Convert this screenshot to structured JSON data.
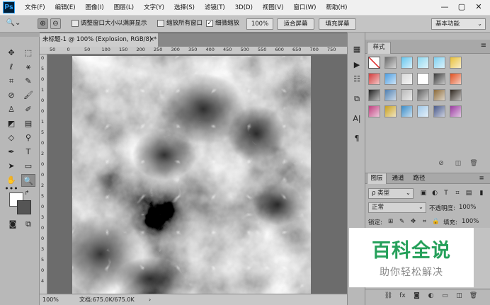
{
  "app": {
    "logo": "Ps"
  },
  "menubar": {
    "items": [
      "文件(F)",
      "编辑(E)",
      "图像(I)",
      "图层(L)",
      "文字(Y)",
      "选择(S)",
      "滤镜(T)",
      "3D(D)",
      "视图(V)",
      "窗口(W)",
      "帮助(H)"
    ],
    "window_controls": {
      "minimize": "—",
      "restore": "▢",
      "close": "✕"
    }
  },
  "options_bar": {
    "resize_windows_label": "调整窗口大小以满屏显示",
    "resize_windows_checked": false,
    "zoom_all_windows_label": "缩放所有窗口",
    "zoom_all_windows_checked": false,
    "scrubby_zoom_label": "细微缩放",
    "scrubby_zoom_checked": true,
    "zoom_value": "100%",
    "fit_screen_label": "适合屏幕",
    "fill_screen_label": "填充屏幕",
    "workspace": "基本功能"
  },
  "document": {
    "tab_title": "未标题-1 @ 100% (Explosion, RGB/8) *",
    "tab_close": "×",
    "ruler_h_ticks": [
      "50",
      "0",
      "50",
      "100",
      "150",
      "200",
      "250",
      "300",
      "350",
      "400",
      "450",
      "500",
      "550",
      "600",
      "650",
      "700",
      "750"
    ],
    "ruler_v_ticks": [
      "0",
      "5",
      "0",
      "1",
      "0",
      "0",
      "1",
      "5",
      "0",
      "2",
      "0",
      "0",
      "2",
      "5",
      "0",
      "3",
      "0",
      "0",
      "3",
      "5",
      "0",
      "4"
    ]
  },
  "status_bar": {
    "zoom": "100%",
    "doc_info": "文档:675.0K/675.0K",
    "arrow": "›"
  },
  "styles_panel": {
    "tab": "样式",
    "menu_icon": "≡",
    "swatch_colors": [
      [
        "#ffffff",
        "#6a6a6a",
        "#66c6ee",
        "#8ed8f0",
        "#7fd0f0",
        "#e8c03a"
      ],
      [
        "#d23b3b",
        "#4c9de0",
        "#d8d8d8",
        "#ffffff",
        "#3a3a3a",
        "#e05020"
      ],
      [
        "#202020",
        "#4f7fb0",
        "#b8b8b8",
        "#606060",
        "#8a6a3a",
        "#302820"
      ],
      [
        "#c04080",
        "#c8a020",
        "#3a8cc8",
        "#a0c8e8",
        "#4a5a8a",
        "#9a3aa0"
      ]
    ]
  },
  "layers_panel": {
    "tabs": [
      "图层",
      "通道",
      "路径"
    ],
    "filter_label": "ρ 类型",
    "blend_mode": "正常",
    "opacity_label": "不透明度:",
    "opacity_value": "100%",
    "lock_label": "锁定:",
    "fill_label": "填充:",
    "fill_value": "100%"
  },
  "watermark": {
    "title": "百科全说",
    "subtitle": "助你轻松解决"
  }
}
